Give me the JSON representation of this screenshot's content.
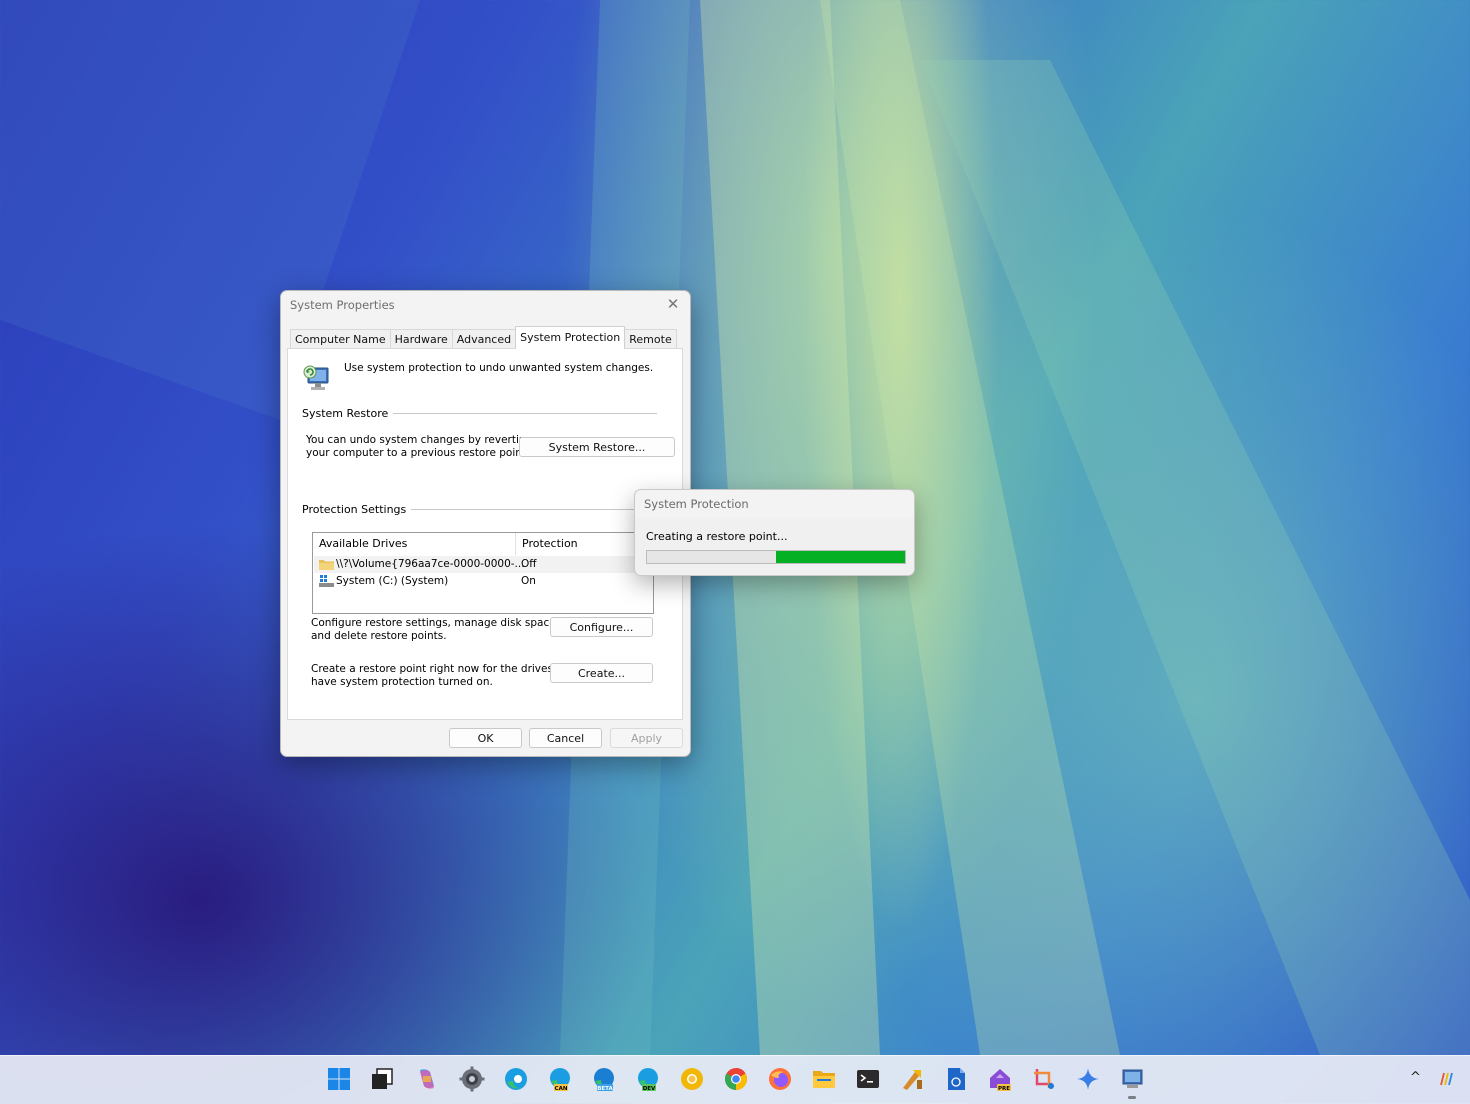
{
  "window": {
    "title": "System Properties",
    "close_glyph": "✕",
    "tabs": [
      {
        "label": "Computer Name",
        "active": false
      },
      {
        "label": "Hardware",
        "active": false
      },
      {
        "label": "Advanced",
        "active": false
      },
      {
        "label": "System Protection",
        "active": true
      },
      {
        "label": "Remote",
        "active": false
      }
    ],
    "intro": "Use system protection to undo unwanted system changes.",
    "system_restore": {
      "heading": "System Restore",
      "description_line1": "You can undo system changes by reverting",
      "description_line2": "your computer to a previous restore point.",
      "button": "System Restore..."
    },
    "protection": {
      "heading": "Protection Settings",
      "columns": [
        "Available Drives",
        "Protection"
      ],
      "rows": [
        {
          "drive": "\\\\?\\Volume{796aa7ce-0000-0000-...",
          "protection": "Off",
          "icon": "folder-icon"
        },
        {
          "drive": "System (C:) (System)",
          "protection": "On",
          "icon": "windows-drive-icon"
        }
      ],
      "configure_text_line1": "Configure restore settings, manage disk space,",
      "configure_text_line2": "and delete restore points.",
      "configure_button": "Configure...",
      "create_text_line1": "Create a restore point right now for the drives that",
      "create_text_line2": "have system protection turned on.",
      "create_button": "Create..."
    },
    "footer": {
      "ok": "OK",
      "cancel": "Cancel",
      "apply": "Apply"
    }
  },
  "popup": {
    "title": "System Protection",
    "message": "Creating a restore point...",
    "progress": {
      "empty_fraction": 0.5,
      "filled_fraction": 0.5
    },
    "progress_color": "#06b025"
  },
  "taskbar": {
    "icons": [
      "windows-start-icon",
      "task-view-icon",
      "copilot-icon",
      "settings-icon",
      "edge-icon",
      "edge-canary-icon",
      "edge-beta-icon",
      "edge-dev-icon",
      "chrome-canary-icon",
      "chrome-icon",
      "firefox-icon",
      "file-explorer-icon",
      "terminal-icon",
      "dev-tools-icon",
      "notepad-icon",
      "powertoys-preview-icon",
      "snipping-tool-icon",
      "copilot-sparkle-icon",
      "system-properties-icon"
    ],
    "badges": {
      "edge-canary-icon": "CAN",
      "edge-beta-icon": "BETA",
      "edge-dev-icon": "DEV",
      "powertoys-preview-icon": "PRE"
    },
    "tray_chevron": "^"
  }
}
